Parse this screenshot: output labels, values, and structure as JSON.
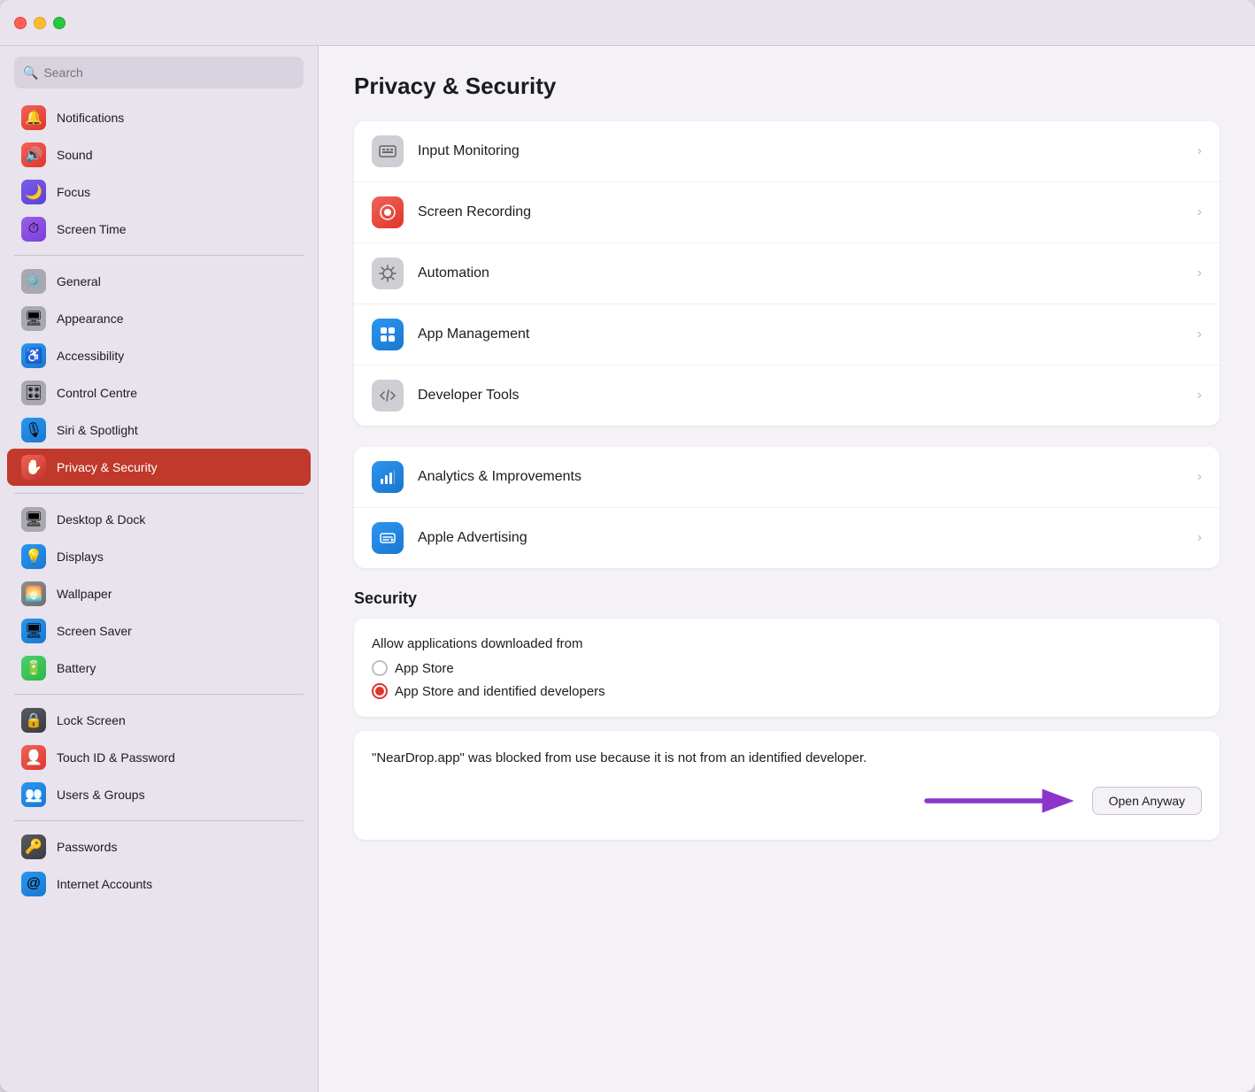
{
  "window": {
    "title": "Privacy & Security"
  },
  "titlebar": {
    "traffic_lights": [
      "red",
      "yellow",
      "green"
    ]
  },
  "sidebar": {
    "search_placeholder": "Search",
    "items_group1": [
      {
        "id": "notifications",
        "label": "Notifications",
        "icon_color": "#e8394a",
        "icon_bg": "#e8394a",
        "icon": "🔔"
      },
      {
        "id": "sound",
        "label": "Sound",
        "icon_color": "#e8394a",
        "icon_bg": "#e8394a",
        "icon": "🔊"
      },
      {
        "id": "focus",
        "label": "Focus",
        "icon_color": "#5b4cdb",
        "icon_bg": "#5b4cdb",
        "icon": "🌙"
      },
      {
        "id": "screen-time",
        "label": "Screen Time",
        "icon_color": "#7b3fdb",
        "icon_bg": "#7b3fdb",
        "icon": "⏱"
      }
    ],
    "items_group2": [
      {
        "id": "general",
        "label": "General",
        "icon_color": "#8e8e93",
        "icon_bg": "#8e8e93",
        "icon": "⚙️"
      },
      {
        "id": "appearance",
        "label": "Appearance",
        "icon_color": "#8e8e93",
        "icon_bg": "#8e8e93",
        "icon": "🖥"
      },
      {
        "id": "accessibility",
        "label": "Accessibility",
        "icon_color": "#1a87e0",
        "icon_bg": "#1a87e0",
        "icon": "♿"
      },
      {
        "id": "control-centre",
        "label": "Control Centre",
        "icon_color": "#8e8e93",
        "icon_bg": "#8e8e93",
        "icon": "🎛"
      },
      {
        "id": "siri-spotlight",
        "label": "Siri & Spotlight",
        "icon_color": "#1a87e0",
        "icon_bg": "#1a87e0",
        "icon": "🎙"
      },
      {
        "id": "privacy-security",
        "label": "Privacy & Security",
        "icon_color": "#e0352b",
        "icon_bg": "#e0352b",
        "icon": "✋",
        "active": true
      }
    ],
    "items_group3": [
      {
        "id": "desktop-dock",
        "label": "Desktop & Dock",
        "icon_color": "#8e8e93",
        "icon_bg": "#8e8e93",
        "icon": "🖥"
      },
      {
        "id": "displays",
        "label": "Displays",
        "icon_color": "#1a87e0",
        "icon_bg": "#1a87e0",
        "icon": "💡"
      },
      {
        "id": "wallpaper",
        "label": "Wallpaper",
        "icon_color": "#8e8e93",
        "icon_bg": "#8e8e93",
        "icon": "🌅"
      },
      {
        "id": "screen-saver",
        "label": "Screen Saver",
        "icon_color": "#1a87e0",
        "icon_bg": "#1a87e0",
        "icon": "🖥"
      },
      {
        "id": "battery",
        "label": "Battery",
        "icon_color": "#3dbb61",
        "icon_bg": "#3dbb61",
        "icon": "🔋"
      }
    ],
    "items_group4": [
      {
        "id": "lock-screen",
        "label": "Lock Screen",
        "icon_color": "#3a3a3c",
        "icon_bg": "#3a3a3c",
        "icon": "🔒"
      },
      {
        "id": "touch-id",
        "label": "Touch ID & Password",
        "icon_color": "#e8394a",
        "icon_bg": "#e8394a",
        "icon": "👤"
      },
      {
        "id": "users-groups",
        "label": "Users & Groups",
        "icon_color": "#1a87e0",
        "icon_bg": "#1a87e0",
        "icon": "👥"
      }
    ],
    "items_group5": [
      {
        "id": "passwords",
        "label": "Passwords",
        "icon_color": "#3a3a3c",
        "icon_bg": "#3a3a3c",
        "icon": "🔑"
      },
      {
        "id": "internet-accounts",
        "label": "Internet Accounts",
        "icon_color": "#1a87e0",
        "icon_bg": "#1a87e0",
        "icon": "📧"
      }
    ]
  },
  "main": {
    "page_title": "Privacy & Security",
    "privacy_rows": [
      {
        "id": "input-monitoring",
        "label": "Input Monitoring",
        "icon_color": "#8e8e93",
        "icon": "⌨"
      },
      {
        "id": "screen-recording",
        "label": "Screen Recording",
        "icon_color": "#e8394a",
        "icon": "⏺"
      },
      {
        "id": "automation",
        "label": "Automation",
        "icon_color": "#8e8e93",
        "icon": "⚙"
      },
      {
        "id": "app-management",
        "label": "App Management",
        "icon_color": "#1a87e0",
        "icon": "📱"
      },
      {
        "id": "developer-tools",
        "label": "Developer Tools",
        "icon_color": "#8e8e93",
        "icon": "🔧"
      }
    ],
    "analytics_rows": [
      {
        "id": "analytics-improvements",
        "label": "Analytics & Improvements",
        "icon_color": "#1a74cc",
        "icon": "📊"
      },
      {
        "id": "apple-advertising",
        "label": "Apple Advertising",
        "icon_color": "#1a87e0",
        "icon": "📣"
      }
    ],
    "security_section": {
      "title": "Security",
      "allow_label": "Allow applications downloaded from",
      "radio_options": [
        {
          "id": "app-store",
          "label": "App Store",
          "selected": false
        },
        {
          "id": "app-store-developers",
          "label": "App Store and identified developers",
          "selected": true
        }
      ],
      "blocked_message": "\"NearDrop.app\" was blocked from use because it is not from an identified developer.",
      "open_anyway_label": "Open Anyway"
    }
  }
}
